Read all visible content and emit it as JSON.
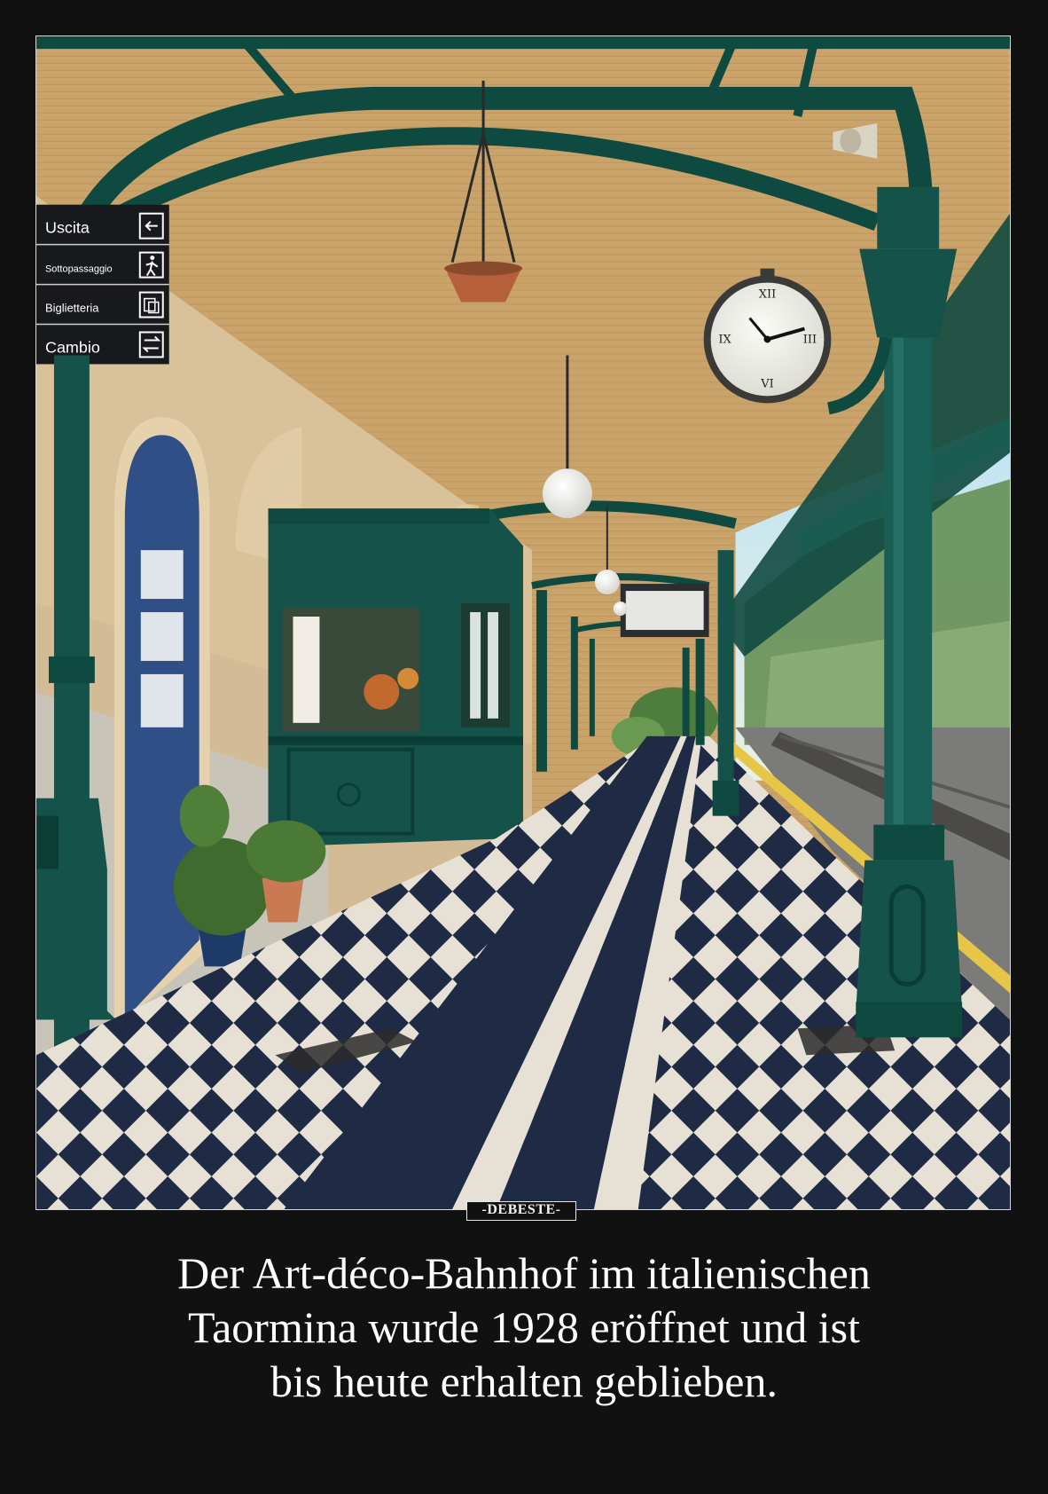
{
  "signs": {
    "exit": "Uscita",
    "underpass": "Sottopassaggio",
    "ticket_office": "Biglietteria",
    "exchange": "Cambio"
  },
  "watermark": "-DEBESTE-",
  "caption": {
    "line1": "Der Art-déco-Bahnhof im italienischen",
    "line2": "Taormina wurde 1928 eröffnet und ist",
    "line3": "bis heute erhalten geblieben."
  },
  "colors": {
    "background": "#111111",
    "iron_green": "#0f4a40",
    "ceiling": "#c9a36a",
    "wall": "#d9c19a",
    "door_blue": "#2f4f86",
    "tile_dark": "#1f2a45",
    "tile_light": "#e6e1d4",
    "caption_text": "#ffffff"
  },
  "icons": [
    "exit-icon",
    "walking-person-icon",
    "ticket-icon",
    "exchange-icon",
    "clock-icon",
    "loudspeaker-icon",
    "pendant-lamp-icon",
    "globe-lamp-icon"
  ]
}
